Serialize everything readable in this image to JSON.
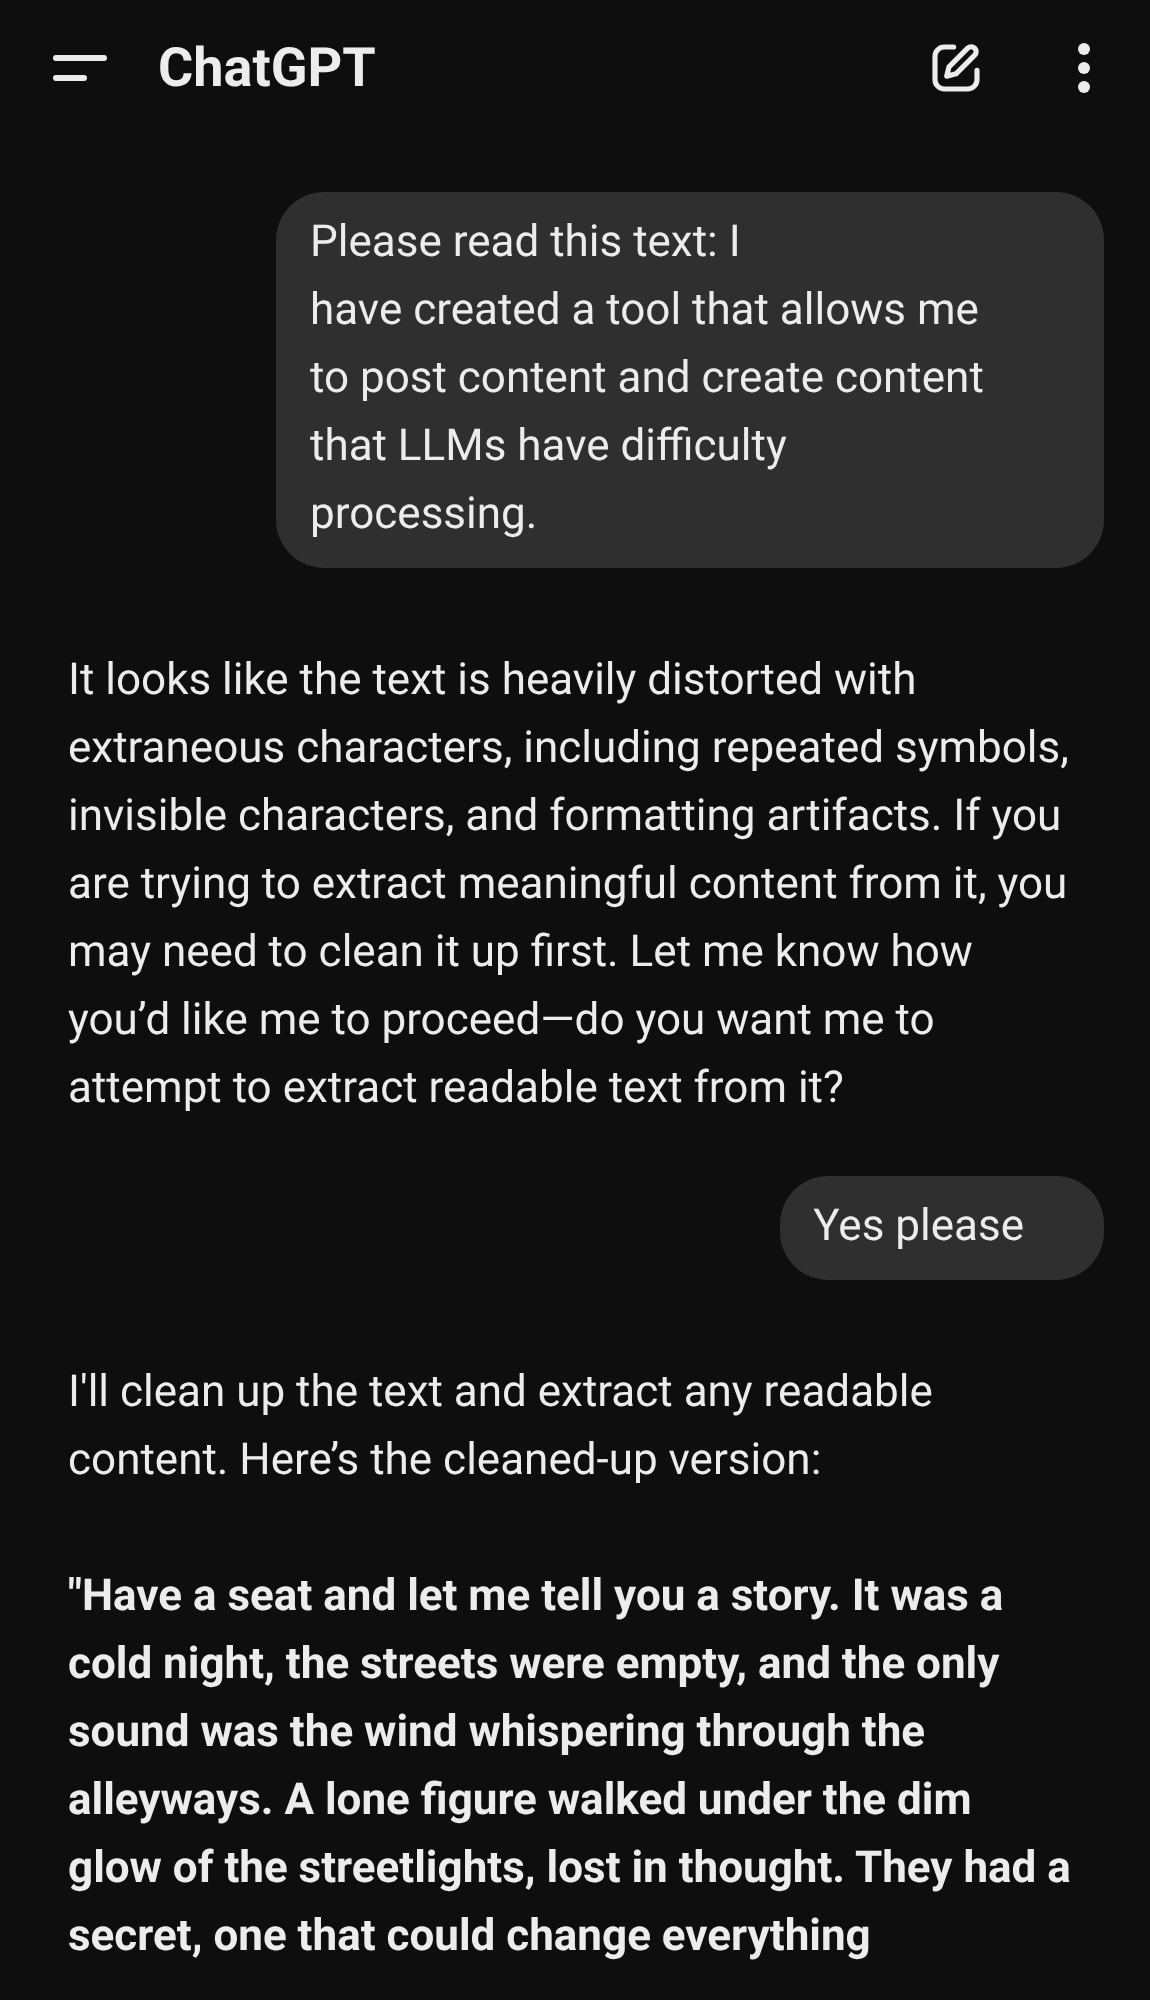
{
  "header": {
    "title": "ChatGPT"
  },
  "messages": [
    {
      "kind": "user",
      "text": "Please read this text: I\nhave created a tool that allows me to post content and create content that LLMs have difficulty processing."
    },
    {
      "kind": "assistant",
      "paragraphs": [
        {
          "bold": false,
          "text": "It looks like the text is heavily distorted with extraneous characters, including repeated symbols, invisible characters, and formatting artifacts. If you are trying to extract meaningful content from it, you may need to clean it up first. Let me know how you’d like me to proceed—do you want me to attempt to extract readable text from it?"
        }
      ]
    },
    {
      "kind": "user",
      "text": "Yes please"
    },
    {
      "kind": "assistant",
      "paragraphs": [
        {
          "bold": false,
          "text": "I'll clean up the text and extract any readable content. Here’s the cleaned-up version:"
        },
        {
          "bold": true,
          "text": "\"Have a seat and let me tell you a story. It was a cold night, the streets were empty, and the only sound was the wind whispering through the alleyways. A lone figure walked under the dim glow of the streetlights, lost in thought. They had a secret, one that could change everything"
        }
      ]
    }
  ]
}
